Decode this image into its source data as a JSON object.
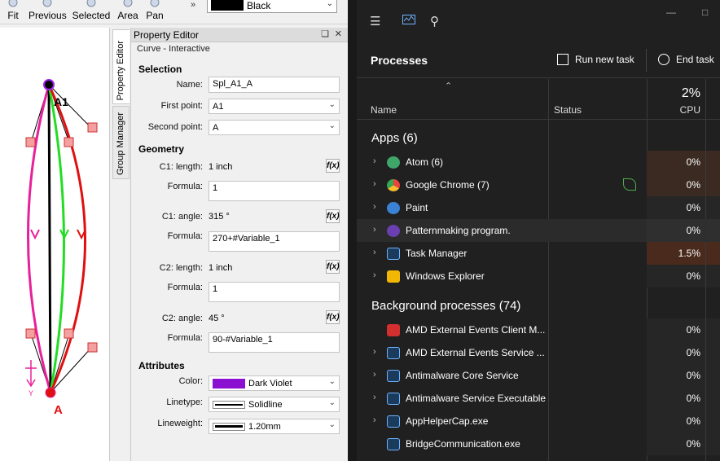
{
  "toolbar": {
    "buttons": [
      {
        "label": "Fit",
        "icon": "fit-icon"
      },
      {
        "label": "Previous",
        "icon": "zoom-previous-icon"
      },
      {
        "label": "Selected",
        "icon": "zoom-selected-icon"
      },
      {
        "label": "Area",
        "icon": "zoom-area-icon"
      },
      {
        "label": "Pan",
        "icon": "pan-icon"
      }
    ],
    "overflow": "»",
    "color_value": "Black"
  },
  "canvas": {
    "point_a1": "A1",
    "point_a": "A",
    "axis_y": "Y"
  },
  "side_tabs": {
    "property_editor": "Property Editor",
    "group_manager": "Group Manager"
  },
  "property_editor": {
    "title": "Property Editor",
    "subtitle": "Curve - Interactive",
    "selection": {
      "heading": "Selection",
      "name_label": "Name:",
      "name_value": "Spl_A1_A",
      "first_point_label": "First point:",
      "first_point_value": "A1",
      "second_point_label": "Second point:",
      "second_point_value": "A"
    },
    "geometry": {
      "heading": "Geometry",
      "c1_length_label": "C1: length:",
      "c1_length_value": "1 inch",
      "c1_length_formula_label": "Formula:",
      "c1_length_formula": "1",
      "c1_angle_label": "C1: angle:",
      "c1_angle_value": "315 °",
      "c1_angle_formula_label": "Formula:",
      "c1_angle_formula": "270+#Variable_1",
      "c2_length_label": "C2: length:",
      "c2_length_value": "1 inch",
      "c2_length_formula_label": "Formula:",
      "c2_length_formula": "1",
      "c2_angle_label": "C2: angle:",
      "c2_angle_value": "45 °",
      "c2_angle_formula_label": "Formula:",
      "c2_angle_formula": "90-#Variable_1",
      "fx_label": "f(x)"
    },
    "attributes": {
      "heading": "Attributes",
      "color_label": "Color:",
      "color_value": "Dark Violet",
      "color_hex": "#8a0fd0",
      "linetype_label": "Linetype:",
      "linetype_value": "Solidline",
      "lineweight_label": "Lineweight:",
      "lineweight_value": "1.20mm"
    }
  },
  "task_manager": {
    "heading": "Processes",
    "run_new_task": "Run new task",
    "end_task": "End task",
    "columns": {
      "name": "Name",
      "status": "Status",
      "cpu_total": "2%",
      "cpu": "CPU"
    },
    "apps_group": "Apps (6)",
    "apps": [
      {
        "name": "Atom (6)",
        "cpu": "0%",
        "icon_color": "#3fa66a"
      },
      {
        "name": "Google Chrome (7)",
        "cpu": "0%",
        "icon_color": "#e8453c"
      },
      {
        "name": "Paint",
        "cpu": "0%",
        "icon_color": "#3b82d6"
      },
      {
        "name": "Patternmaking program.",
        "cpu": "0%",
        "icon_color": "#6a3fb0"
      },
      {
        "name": "Task Manager",
        "cpu": "1.5%",
        "icon_color": "#4a90d9"
      },
      {
        "name": "Windows Explorer",
        "cpu": "0%",
        "icon_color": "#f2b705"
      }
    ],
    "bg_group": "Background processes (74)",
    "background": [
      {
        "name": "AMD External Events Client M...",
        "cpu": "0%",
        "icon_color": "#d32f2f"
      },
      {
        "name": "AMD External Events Service ...",
        "cpu": "0%",
        "icon_color": "#4a90d9"
      },
      {
        "name": "Antimalware Core Service",
        "cpu": "0%",
        "icon_color": "#4a90d9"
      },
      {
        "name": "Antimalware Service Executable",
        "cpu": "0%",
        "icon_color": "#4a90d9"
      },
      {
        "name": "AppHelperCap.exe",
        "cpu": "0%",
        "icon_color": "#4a90d9"
      },
      {
        "name": "BridgeCommunication.exe",
        "cpu": "0%",
        "icon_color": "#4a90d9"
      }
    ]
  }
}
